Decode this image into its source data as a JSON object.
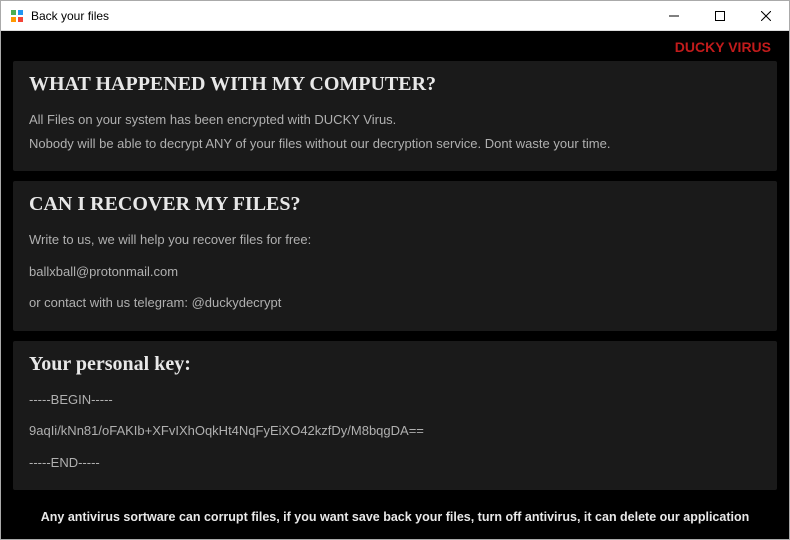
{
  "window": {
    "title": "Back your files"
  },
  "banner": {
    "text": "DUCKY VIRUS"
  },
  "section1": {
    "heading": "WHAT HAPPENED WITH MY COMPUTER?",
    "line1": "All Files on your system has been encrypted with DUCKY Virus.",
    "line2": "Nobody will be able to decrypt ANY of your files without our decryption service. Dont waste your time."
  },
  "section2": {
    "heading": "CAN I RECOVER MY FILES?",
    "line1": "Write to us, we will help you recover files for free:",
    "email": "ballxball@protonmail.com",
    "line2": "or contact with us telegram: @duckydecrypt"
  },
  "section3": {
    "heading": "Your personal key:",
    "begin": "-----BEGIN-----",
    "key": "9aqIi/kNn81/oFAKIb+XFvIXhOqkHt4NqFyEiXO42kzfDy/M8bqgDA==",
    "end": "-----END-----"
  },
  "footer": {
    "text": "Any antivirus sortware can corrupt files, if you want save back your files, turn off antivirus, it can delete our application"
  }
}
